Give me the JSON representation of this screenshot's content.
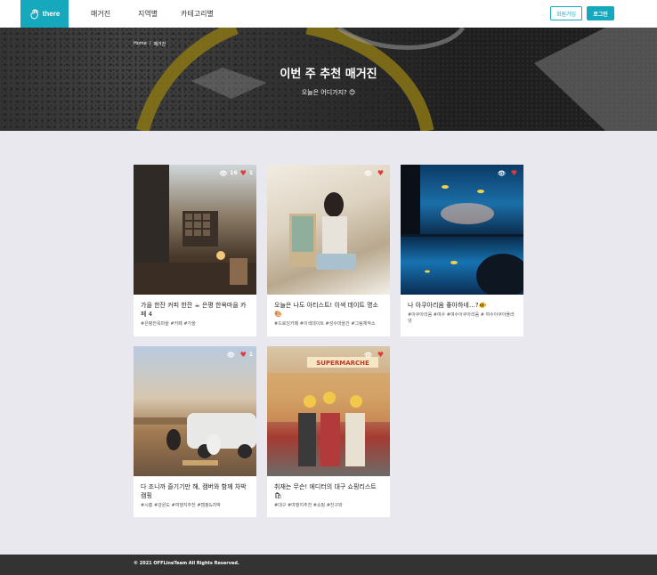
{
  "header": {
    "logo_text": "there",
    "nav": [
      "매거진",
      "지역별",
      "카테고리별"
    ],
    "signup_label": "회원가입",
    "login_label": "로그인",
    "accent": "#16a9bd"
  },
  "hero": {
    "breadcrumb": [
      "Home",
      "/",
      "매거진"
    ],
    "title": "이번 주 추천 매거진",
    "subtitle": "오늘은 어디가지? 😊"
  },
  "cards": [
    {
      "title": "가을 한잔 커피 한잔 ☕ 은평 한옥마을 카페 4",
      "tags": "#은평한옥마을 #카페 #가을",
      "views": "16",
      "likes": "1"
    },
    {
      "title": "오늘은 나도 아티스트! 이색 데이트 명소🎨",
      "tags": "#드로잉카페 #이색데이트 #성수마을건 #그림체작소",
      "views": "",
      "likes": ""
    },
    {
      "title": "나 아쿠아리움 좋아하네…?🐠",
      "tags": "#아쿠아리움 #여수 #여수아쿠아리움 # 여수아쿠아플라넷",
      "views": "",
      "likes": ""
    },
    {
      "title": "다 조니까 즐기기만 해, 캠버와 함께 차박캠핑",
      "tags": "#시흥 #강원도 #여행지추천 #캠핑&차박",
      "views": "",
      "likes": "1"
    },
    {
      "title": "취재는 무슨! 에디터의 대구 쇼핑리스트🛍",
      "tags": "#대구 #여행지추천 #쇼핑 #친구와",
      "views": "",
      "likes": ""
    }
  ],
  "icons": {
    "views": "eye-icon",
    "likes": "heart-icon"
  },
  "footer": {
    "text": "© 2021 OFFLineTeam All Rights Reserved."
  }
}
